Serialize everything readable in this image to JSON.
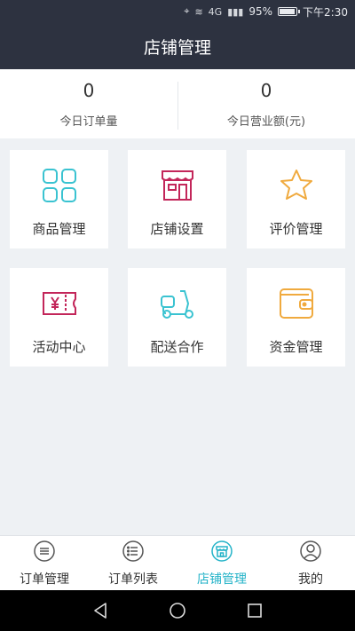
{
  "status_bar": {
    "signal": "4G",
    "battery_text": "95%",
    "battery_level": 0.95,
    "time": "下午2:30"
  },
  "header": {
    "title": "店铺管理"
  },
  "stats": [
    {
      "value": "0",
      "label": "今日订单量"
    },
    {
      "value": "0",
      "label": "今日营业额(元)"
    }
  ],
  "tiles": [
    {
      "label": "商品管理",
      "icon": "grid-icon",
      "color": "#3ac3d1"
    },
    {
      "label": "店铺设置",
      "icon": "shop-icon",
      "color": "#c3265a"
    },
    {
      "label": "评价管理",
      "icon": "star-icon",
      "color": "#f0aa3e"
    },
    {
      "label": "活动中心",
      "icon": "coupon-icon",
      "color": "#c3265a"
    },
    {
      "label": "配送合作",
      "icon": "scooter-icon",
      "color": "#3ac3d1"
    },
    {
      "label": "资金管理",
      "icon": "wallet-icon",
      "color": "#f0aa3e"
    }
  ],
  "tabbar": [
    {
      "label": "订单管理",
      "icon": "order-manage-icon",
      "active": false
    },
    {
      "label": "订单列表",
      "icon": "order-list-icon",
      "active": false
    },
    {
      "label": "店铺管理",
      "icon": "shop-manage-icon",
      "active": true
    },
    {
      "label": "我的",
      "icon": "profile-icon",
      "active": false
    }
  ],
  "colors": {
    "header_bg": "#2d3240",
    "accent": "#24b3c8",
    "page_bg": "#eef1f4"
  }
}
